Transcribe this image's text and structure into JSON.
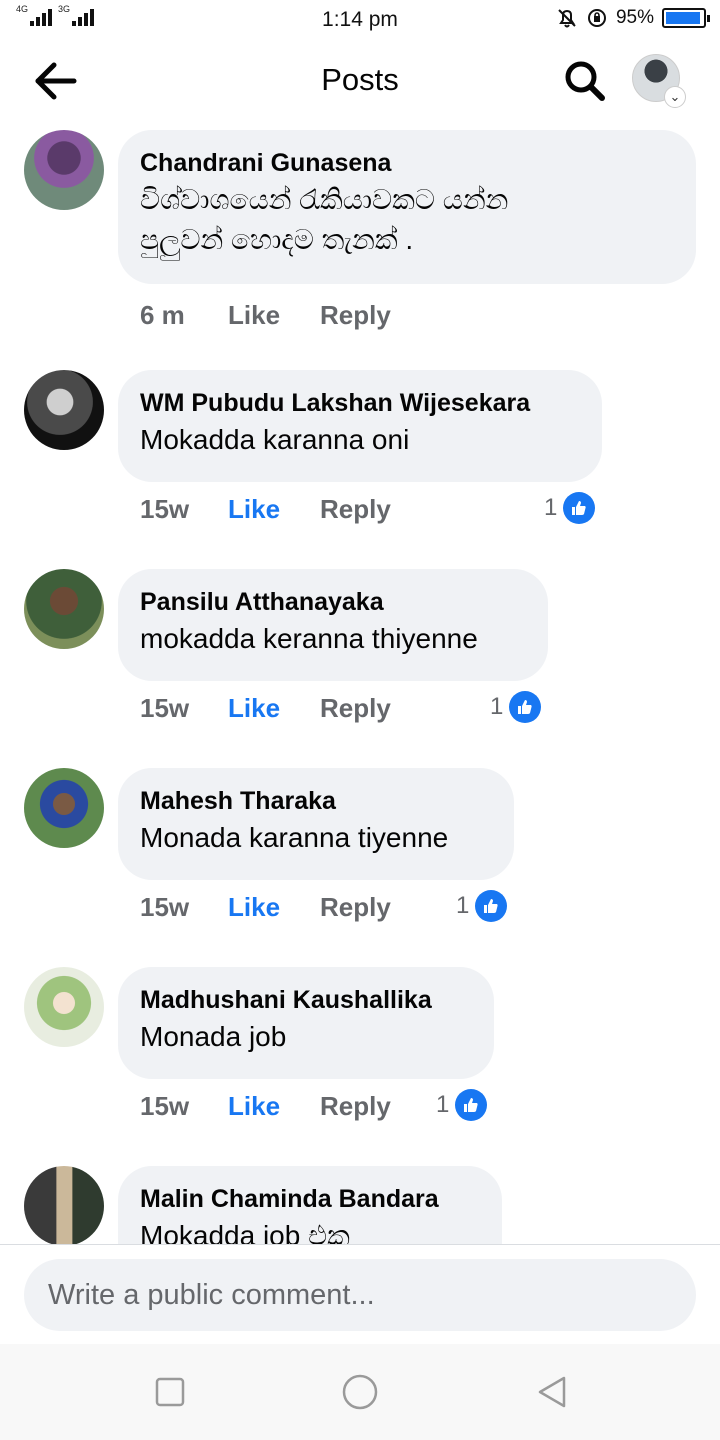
{
  "status_bar": {
    "network_a": "4G",
    "network_b": "3G",
    "time": "1:14 pm",
    "battery": "95%",
    "battery_level": 0.95,
    "icons": [
      "mute-bell-icon",
      "data-saver-icon",
      "battery-icon"
    ]
  },
  "header": {
    "title": "Posts",
    "back_icon": "arrow-left-icon",
    "search_icon": "search-icon",
    "profile_icon": "profile-avatar-icon"
  },
  "colors": {
    "accent": "#1877f2",
    "bubble": "#f0f2f5",
    "secondary_text": "#65676b"
  },
  "comments": [
    {
      "author": "Chandrani Gunasena",
      "text_lines": [
        "විශ්වාශයෙන් රැකියාවකට යන්න",
        "පුලුවන් හොදම තැනක් ."
      ],
      "time": "6 m",
      "like": "Like",
      "reply": "Reply",
      "liked": false,
      "reactions": ""
    },
    {
      "author": "WM Pubudu Lakshan Wijesekara",
      "text_lines": [
        "Mokadda karanna oni"
      ],
      "time": "15w",
      "like": "Like",
      "reply": "Reply",
      "liked": true,
      "reactions": "1"
    },
    {
      "author": "Pansilu Atthanayaka",
      "text_lines": [
        "mokadda keranna thiyenne"
      ],
      "time": "15w",
      "like": "Like",
      "reply": "Reply",
      "liked": true,
      "reactions": "1"
    },
    {
      "author": "Mahesh Tharaka",
      "text_lines": [
        "Monada karanna tiyenne"
      ],
      "time": "15w",
      "like": "Like",
      "reply": "Reply",
      "liked": true,
      "reactions": "1"
    },
    {
      "author": "Madhushani Kaushallika",
      "text_lines": [
        "Monada job"
      ],
      "time": "15w",
      "like": "Like",
      "reply": "Reply",
      "liked": true,
      "reactions": "1"
    },
    {
      "author": "Malin Chaminda Bandara",
      "text_lines": [
        "Mokadda job එක"
      ],
      "time": "",
      "like": "",
      "reply": "",
      "liked": false,
      "reactions": ""
    }
  ],
  "composer": {
    "placeholder": "Write a public comment..."
  },
  "system_nav": {
    "icons": [
      "recents-square-icon",
      "home-circle-icon",
      "back-triangle-icon"
    ]
  }
}
